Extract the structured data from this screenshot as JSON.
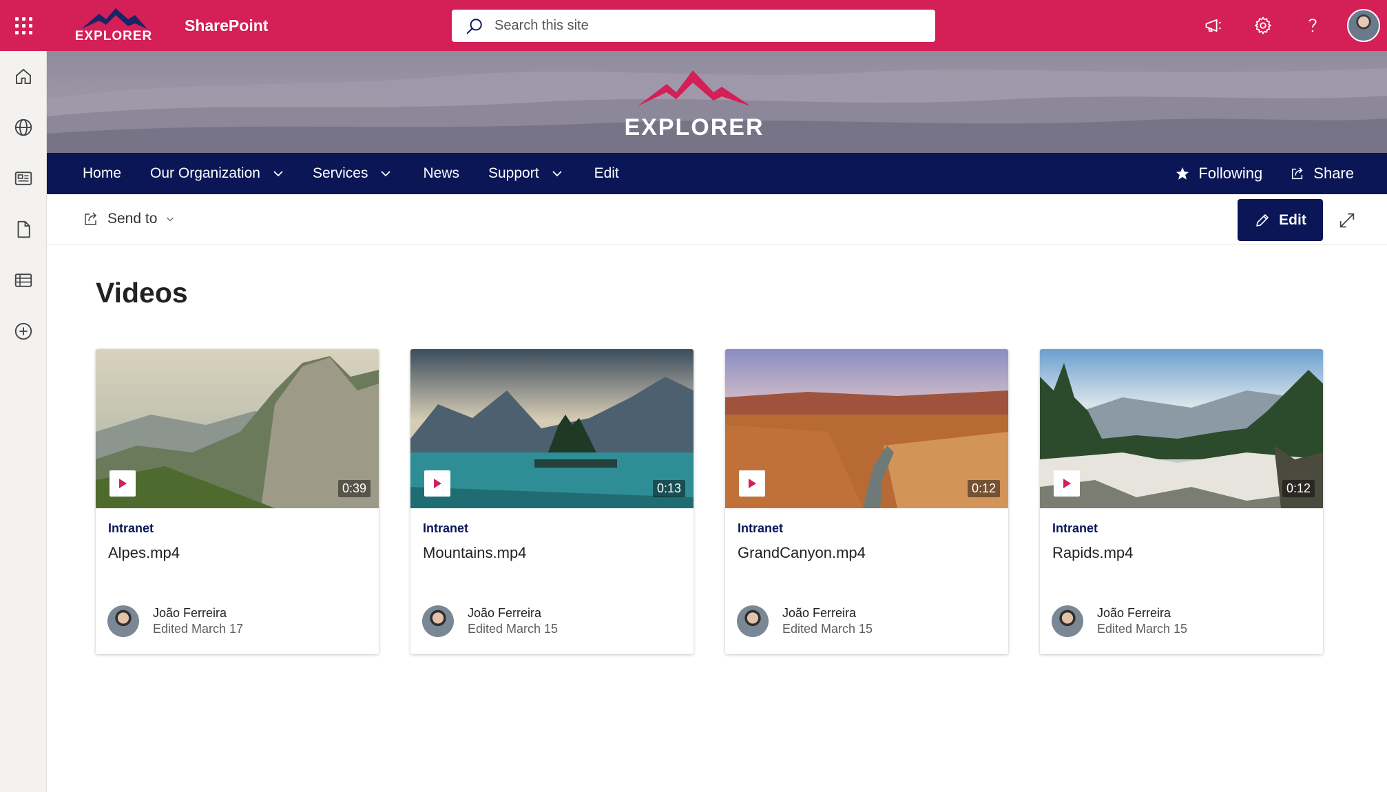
{
  "suite_bar": {
    "logo_text": "EXPLORER",
    "app_name": "SharePoint",
    "search_placeholder": "Search this site"
  },
  "banner": {
    "logo_text": "EXPLORER"
  },
  "nav": {
    "items": [
      {
        "label": "Home",
        "has_dropdown": false
      },
      {
        "label": "Our Organization",
        "has_dropdown": true
      },
      {
        "label": "Services",
        "has_dropdown": true
      },
      {
        "label": "News",
        "has_dropdown": false
      },
      {
        "label": "Support",
        "has_dropdown": true
      },
      {
        "label": "Edit",
        "has_dropdown": false
      }
    ],
    "following_label": "Following",
    "share_label": "Share"
  },
  "commandbar": {
    "send_to_label": "Send to",
    "edit_label": "Edit"
  },
  "section": {
    "title": "Videos"
  },
  "videos": [
    {
      "site": "Intranet",
      "title": "Alpes.mp4",
      "duration": "0:39",
      "author": "João Ferreira",
      "edited": "Edited March 17"
    },
    {
      "site": "Intranet",
      "title": "Mountains.mp4",
      "duration": "0:13",
      "author": "João Ferreira",
      "edited": "Edited March 15"
    },
    {
      "site": "Intranet",
      "title": "GrandCanyon.mp4",
      "duration": "0:12",
      "author": "João Ferreira",
      "edited": "Edited March 15"
    },
    {
      "site": "Intranet",
      "title": "Rapids.mp4",
      "duration": "0:12",
      "author": "João Ferreira",
      "edited": "Edited March 15"
    }
  ],
  "colors": {
    "suite_bar": "#d41f57",
    "nav": "#0b1657",
    "accent": "#0b1657",
    "play_icon": "#d41f57"
  },
  "icons": {
    "waffle": "app-launcher-icon",
    "search": "search-icon",
    "megaphone": "megaphone-icon",
    "settings": "gear-icon",
    "help": "help-icon",
    "rail": [
      "home-icon",
      "globe-icon",
      "news-icon",
      "document-icon",
      "list-icon",
      "add-circle-icon"
    ]
  }
}
